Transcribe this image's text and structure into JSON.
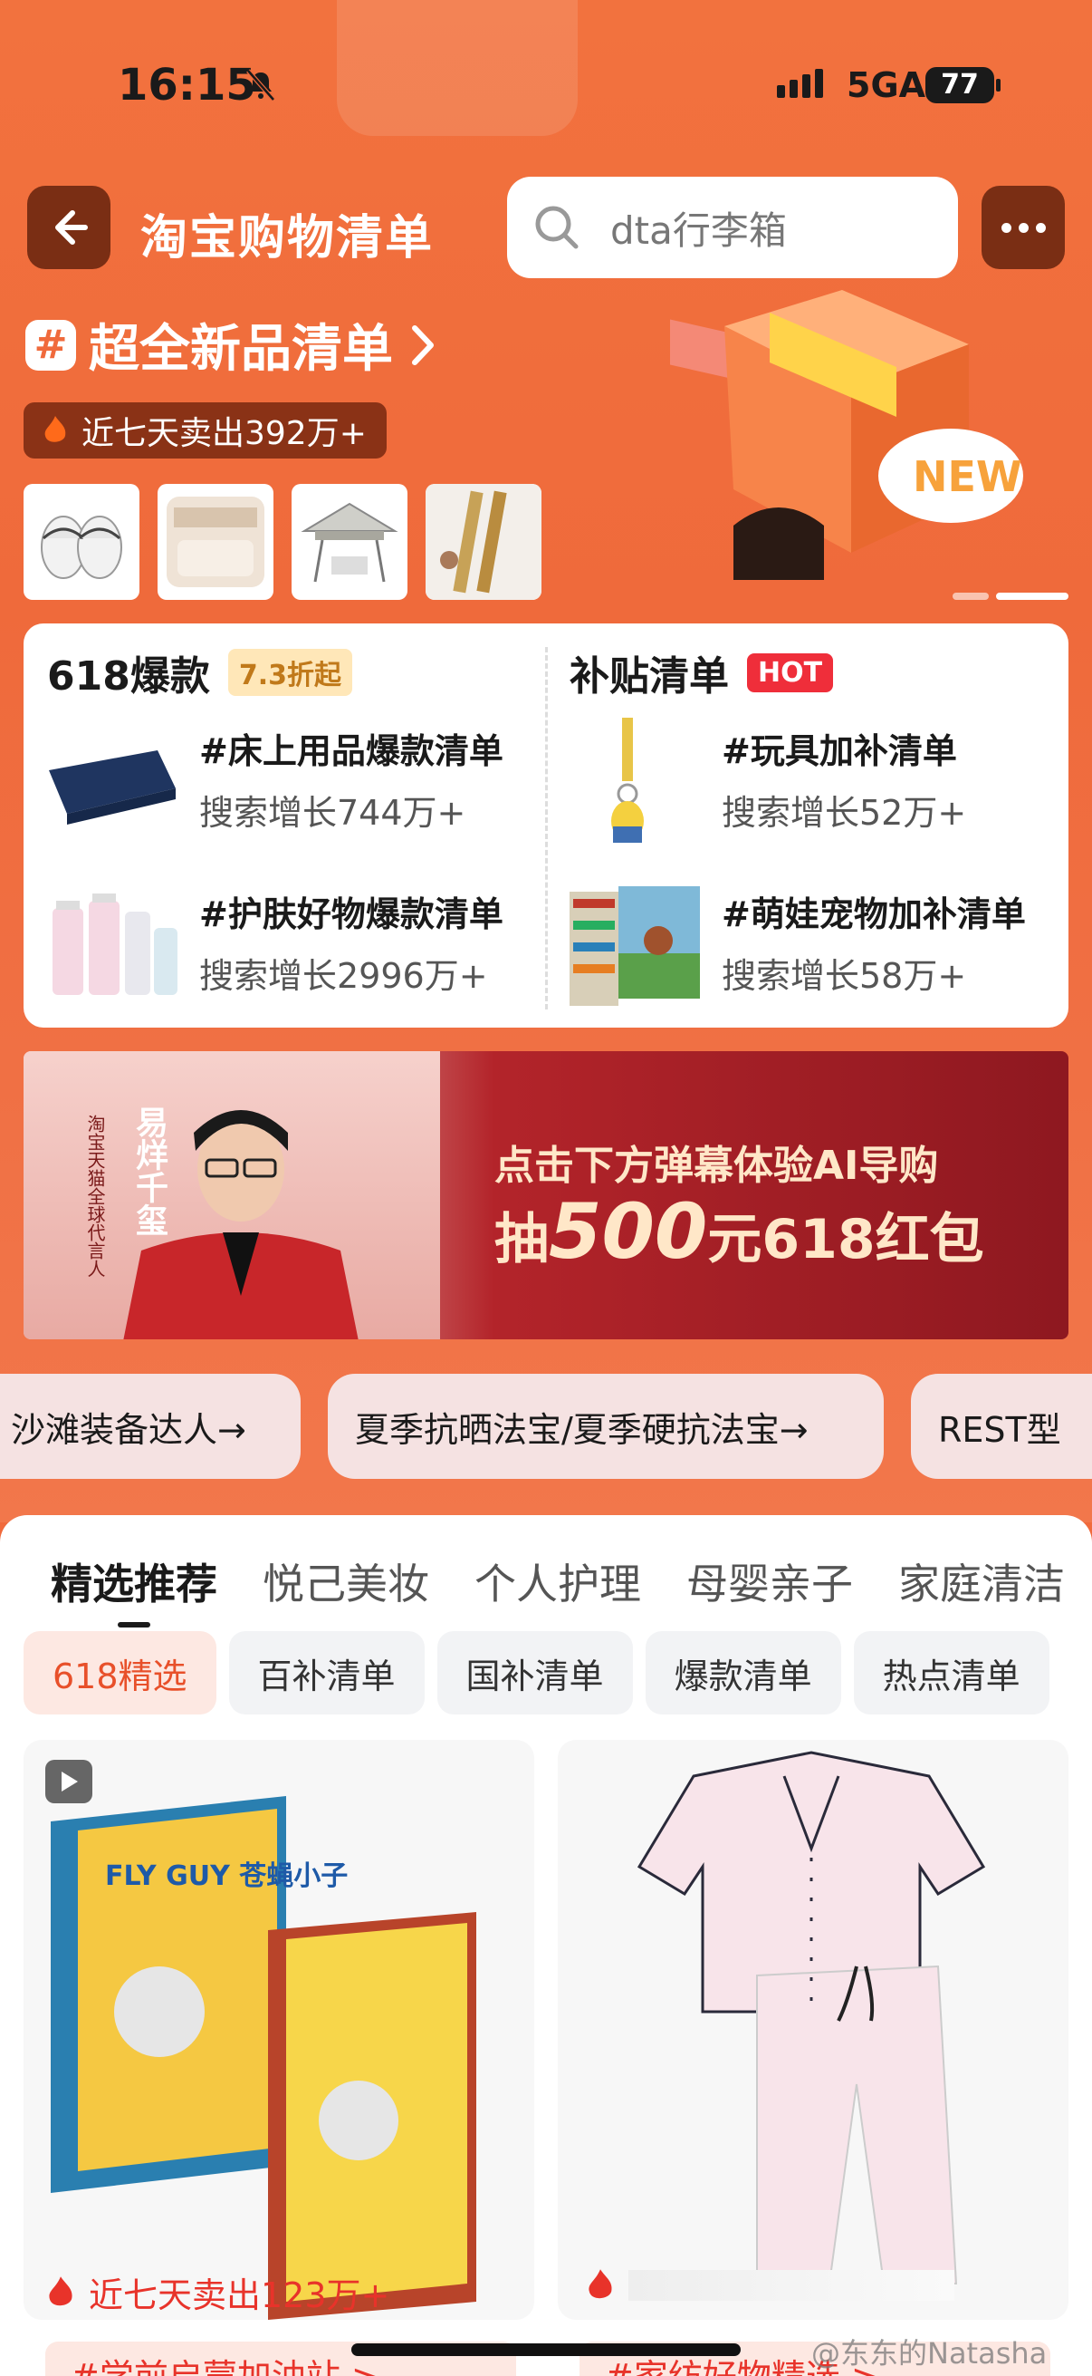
{
  "status_bar": {
    "time": "16:15",
    "network": "5GA",
    "battery": "77"
  },
  "nav": {
    "title": "淘宝购物清单",
    "search_placeholder": "dta行李箱"
  },
  "new_products": {
    "title": "超全新品清单",
    "hash_symbol": "#",
    "sold_text": "近七天卖出392万+",
    "badge": "NEW"
  },
  "hot_section": {
    "title": "618爆款",
    "badge": "7.3折起",
    "items": [
      {
        "name": "#床上用品爆款清单",
        "sub": "搜索增长744万+"
      },
      {
        "name": "#护肤好物爆款清单",
        "sub": "搜索增长2996万+"
      }
    ]
  },
  "subsidy_section": {
    "title": "补贴清单",
    "badge": "HOT",
    "items": [
      {
        "name": "#玩具加补清单",
        "sub": "搜索增长52万+"
      },
      {
        "name": "#萌娃宠物加补清单",
        "sub": "搜索增长58万+"
      }
    ]
  },
  "promo": {
    "line1": "点击下方弹幕体验AI导购",
    "line2_prefix": "抽",
    "line2_amount": "500",
    "line2_suffix": "元618红包",
    "spokesperson_name": "易烊千玺",
    "spokesperson_title": "淘宝天猫全球代言人"
  },
  "chips": [
    "沙滩装备达人→",
    "夏季抗晒法宝/夏季硬抗法宝→",
    "REST型"
  ],
  "category_tabs": [
    "精选推荐",
    "悦己美妆",
    "个人护理",
    "母婴亲子",
    "家庭清洁"
  ],
  "sub_tabs": [
    "618精选",
    "百补清单",
    "国补清单",
    "爆款清单",
    "热点清单"
  ],
  "products": [
    {
      "stat": "近七天卖出123万+",
      "tag": "#学前启蒙加油站 >",
      "book_title": "FLY GUY 苍蝇小子"
    },
    {
      "tag": "#家纺好物精选 >"
    }
  ],
  "watermark": "@东东的Natasha",
  "colors": {
    "brand": "#f06a3c",
    "hot_badge": "#ef2e3a",
    "accent_red": "#e8332a"
  }
}
